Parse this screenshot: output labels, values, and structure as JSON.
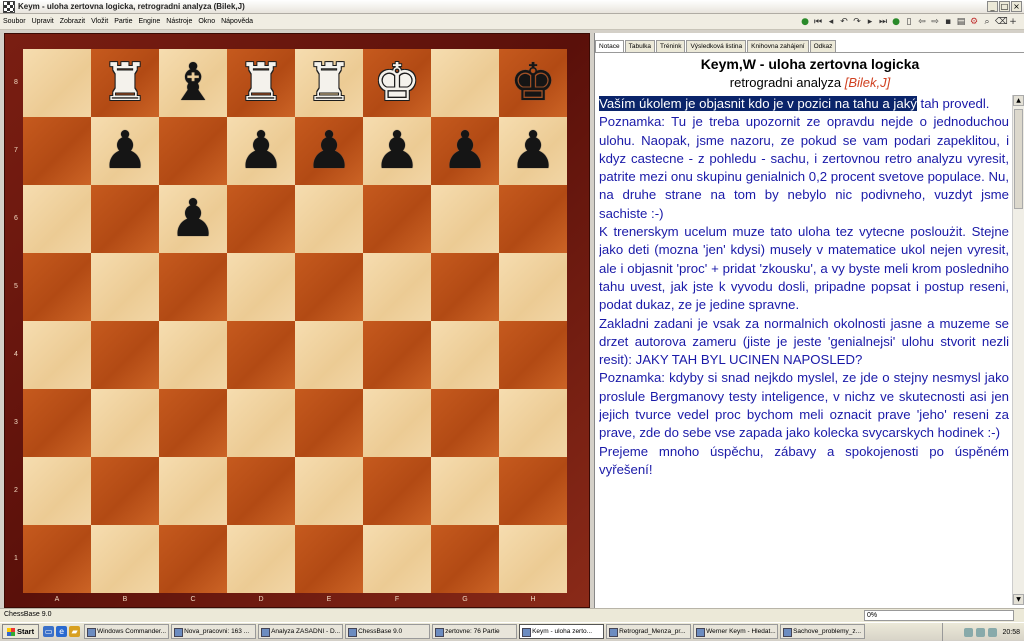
{
  "window": {
    "title": "Keym - uloha zertovna logicka, retrogradni analyza  (Bilek,J)"
  },
  "menu": [
    "Soubor",
    "Upravit",
    "Zobrazit",
    "Vložit",
    "Partie",
    "Engine",
    "Nástroje",
    "Okno",
    "Nápověda"
  ],
  "toolbar_icons": [
    "go-start-icon",
    "first-icon",
    "prev-icon",
    "undo-icon",
    "redo-icon",
    "next-icon",
    "last-icon",
    "go-end-icon",
    "new-icon",
    "back-icon",
    "forward-icon",
    "save-icon",
    "print-icon",
    "engine-icon",
    "find-icon",
    "eraser-icon",
    "add-icon"
  ],
  "board": {
    "ranks": [
      "8",
      "7",
      "6",
      "5",
      "4",
      "3",
      "2",
      "1"
    ],
    "files": [
      "A",
      "B",
      "C",
      "D",
      "E",
      "F",
      "G",
      "H"
    ],
    "rows": [
      [
        "",
        "wR",
        "bB",
        "wR",
        "wR",
        "wK",
        "",
        "bK"
      ],
      [
        "",
        "bP",
        "",
        "bP",
        "bP",
        "bP",
        "bP",
        "bP"
      ],
      [
        "",
        "",
        "bP",
        "",
        "",
        "",
        "",
        ""
      ],
      [
        "",
        "",
        "",
        "",
        "",
        "",
        "",
        ""
      ],
      [
        "",
        "",
        "",
        "",
        "",
        "",
        "",
        ""
      ],
      [
        "",
        "",
        "",
        "",
        "",
        "",
        "",
        ""
      ],
      [
        "",
        "",
        "",
        "",
        "",
        "",
        "",
        ""
      ],
      [
        "",
        "",
        "",
        "",
        "",
        "",
        "",
        ""
      ]
    ]
  },
  "tabs": [
    "Notace",
    "Tabulka",
    "Trénink",
    "Výsledková listina",
    "Knihovna zahájení",
    "Odkaz"
  ],
  "game": {
    "title": "Keym,W - uloha zertovna logicka",
    "subtitle": "retrogradni analyza",
    "author": "[Bilek,J]"
  },
  "notation": {
    "highlight": "Vaším úkolem je objasnit kdo je v pozici na tahu a jaký",
    "rest": " tah provedl.",
    "paragraphs": [
      "Poznamka: Tu je treba upozornit ze opravdu nejde o jednoduchou ulohu. Naopak, jsme nazoru, ze pokud se vam podari zapeklitou, i kdyz castecne - z pohledu - sachu, i zertovnou retro analyzu vyresit, patrite mezi onu skupinu genialnich 0,2 procent svetove populace. Nu, na druhe strane na tom by nebylo nic podivneho, vuzdyt jsme sachiste :-)",
      "K trenerskym ucelum muze tato uloha tez vytecne posloużit. Stejne jako deti (mozna 'jen' kdysi) musely v matematice ukol nejen vyresit, ale i objasnit 'proc' + pridat 'zkousku', a vy byste meli krom posledniho tahu uvest, jak jste k vyvodu dosli, pripadne popsat i postup reseni, podat dukaz, ze je jedine spravne.",
      "Zakladni zadani je vsak za normalnich okolnosti jasne a muzeme se drzet autorova zameru (jiste je jeste 'genialnejsi' ulohu stvorit nezli resit): JAKY TAH BYL UCINEN NAPOSLED?",
      "Poznamka: kdyby si snad nejkdo myslel, ze jde o stejny nesmysl jako proslule Bergmanovy testy inteligence, v nichz ve skutecnosti asi jen jejich tvurce vedel proc bychom meli oznacit prave 'jeho' reseni za prave, zde do sebe vse zapada jako kolecka svycarskych hodinek :-)",
      "Prejeme mnoho úspěchu, zábavy a spokojenosti po úspěném vyřešení!"
    ]
  },
  "status": {
    "text": "ChessBase 9.0",
    "progress": "0%"
  },
  "taskbar": {
    "start": "Start",
    "tasks": [
      "Windows Commander...",
      "Nova_pracovni: 163 ...",
      "Analyza ZASADNI - D...",
      "ChessBase 9.0",
      "zertovne: 76 Partie",
      "Keym - uloha zerto...",
      "Retrograd_Menza_pr...",
      "Werner Keym - Hledat...",
      "Sachove_problemy_z..."
    ],
    "active_index": 5,
    "clock": "20:58"
  }
}
